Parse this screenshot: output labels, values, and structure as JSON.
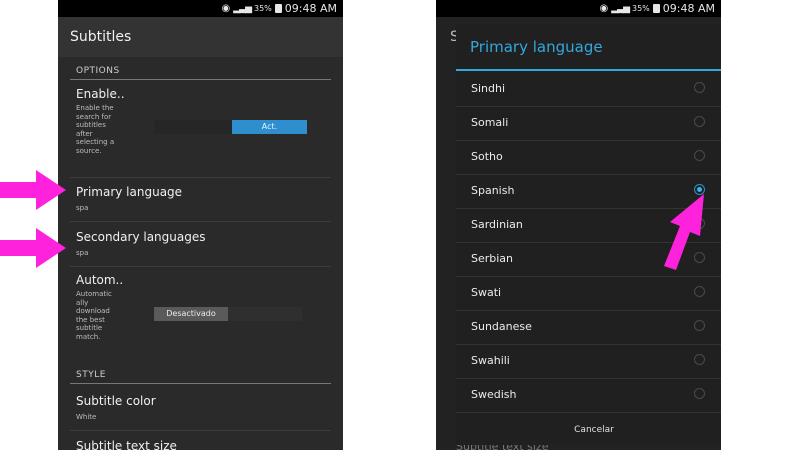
{
  "status": {
    "battery": "35%",
    "time": "09:48 AM"
  },
  "left": {
    "title": "Subtitles",
    "options_header": "OPTIONS",
    "enable_title": "Enable..",
    "enable_desc": [
      "Enable the",
      "search for",
      "subtitles",
      "after",
      "selecting a",
      "source."
    ],
    "enable_button": "Act.",
    "primary_title": "Primary language",
    "primary_value": "spa",
    "secondary_title": "Secondary languages",
    "secondary_value": "spa",
    "auto_title": "Autom..",
    "auto_desc": [
      "Automatic",
      "ally",
      "download",
      "the best",
      "subtitle",
      "match."
    ],
    "auto_button": "Desactivado",
    "style_header": "STYLE",
    "color_title": "Subtitle color",
    "color_value": "White",
    "size_title": "Subtitle text size"
  },
  "right": {
    "bg_letter": "S",
    "bg_bottom": "Subtitle text size",
    "dialog_title": "Primary language",
    "options": [
      {
        "label": "Sindhi",
        "selected": false
      },
      {
        "label": "Somali",
        "selected": false
      },
      {
        "label": "Sotho",
        "selected": false
      },
      {
        "label": "Spanish",
        "selected": true
      },
      {
        "label": "Sardinian",
        "selected": false
      },
      {
        "label": "Serbian",
        "selected": false
      },
      {
        "label": "Swati",
        "selected": false
      },
      {
        "label": "Sundanese",
        "selected": false
      },
      {
        "label": "Swahili",
        "selected": false
      },
      {
        "label": "Swedish",
        "selected": false
      }
    ],
    "cancel": "Cancelar"
  },
  "colors": {
    "accent": "#33b5e5",
    "annotation": "#ff22dd",
    "background": "#2a2a2a"
  }
}
